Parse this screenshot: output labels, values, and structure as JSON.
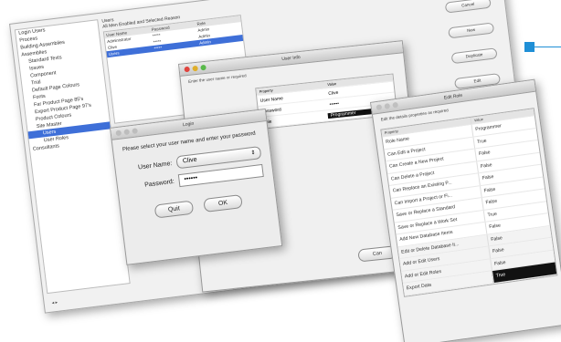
{
  "main_window": {
    "tree_items": [
      {
        "label": "Login Users",
        "indent": 0,
        "selected": false
      },
      {
        "label": "Process",
        "indent": 0,
        "selected": false
      },
      {
        "label": "Building Assemblies",
        "indent": 0,
        "selected": false
      },
      {
        "label": "Assemblies",
        "indent": 0,
        "selected": false
      },
      {
        "label": "Standard Texts",
        "indent": 1,
        "selected": false
      },
      {
        "label": "Issues",
        "indent": 1,
        "selected": false
      },
      {
        "label": "Component",
        "indent": 1,
        "selected": false
      },
      {
        "label": "Trial",
        "indent": 1,
        "selected": false
      },
      {
        "label": "Default Page Colours",
        "indent": 1,
        "selected": false
      },
      {
        "label": "Fonts",
        "indent": 1,
        "selected": false
      },
      {
        "label": "Far Product Page 85's",
        "indent": 1,
        "selected": false
      },
      {
        "label": "Export Product Page 97's",
        "indent": 1,
        "selected": false
      },
      {
        "label": "Product Colours",
        "indent": 1,
        "selected": false
      },
      {
        "label": "Site Master",
        "indent": 1,
        "selected": false
      },
      {
        "label": "Users",
        "indent": 2,
        "selected": true
      },
      {
        "label": "User Roles",
        "indent": 2,
        "selected": false
      },
      {
        "label": "Consultants",
        "indent": 0,
        "selected": false
      }
    ],
    "users_heading": "Users",
    "users_caption": "All Men Enabled and Selected Reason",
    "users_columns": [
      "User Name",
      "Password",
      "Role"
    ],
    "users_rows": [
      {
        "cells": [
          "Administrator",
          "*****",
          "Admin"
        ],
        "selected": false
      },
      {
        "cells": [
          "Clive",
          "*****",
          "Admin"
        ],
        "selected": false
      },
      {
        "cells": [
          "Users",
          "*****",
          "Admin"
        ],
        "selected": true
      }
    ],
    "side_buttons": [
      "OK",
      "Cancel",
      "New",
      "Duplicate",
      "Edit",
      "Delete"
    ]
  },
  "user_window": {
    "title": "User Info",
    "instruction": "Enter the user name or required",
    "columns": [
      "Property",
      "Value"
    ],
    "rows": [
      {
        "cells": [
          "User Name",
          "Clive"
        ],
        "black": false
      },
      {
        "cells": [
          "Password",
          "••••••"
        ],
        "black": false
      },
      {
        "cells": [
          "Role",
          "Programmer"
        ],
        "black": true
      }
    ],
    "cancel_label": "Can"
  },
  "login_window": {
    "title": "Login",
    "message": "Please select your user name and enter your password",
    "username_label": "User Name:",
    "username_value": "Clive",
    "password_label": "Password:",
    "password_value": "••••••",
    "quit_label": "Quit",
    "ok_label": "OK"
  },
  "role_window": {
    "title": "Edit Role",
    "instruction": "Edit the details properties as required",
    "columns": [
      "Property",
      "Value"
    ],
    "rows": [
      {
        "cells": [
          "Role Name",
          "Programmer"
        ],
        "alt": false,
        "black": false
      },
      {
        "cells": [
          "Can Edit a Project",
          "True"
        ],
        "alt": false,
        "black": false
      },
      {
        "cells": [
          "Can Create a New Project",
          "False"
        ],
        "alt": false,
        "black": false
      },
      {
        "cells": [
          "Can Delete a Project",
          "False"
        ],
        "alt": false,
        "black": false
      },
      {
        "cells": [
          "Can Replace an Existing P...",
          "False"
        ],
        "alt": false,
        "black": false
      },
      {
        "cells": [
          "Can Import a Project or Fi...",
          "False"
        ],
        "alt": false,
        "black": false
      },
      {
        "cells": [
          "Save or Replace a Standard",
          "False"
        ],
        "alt": false,
        "black": false
      },
      {
        "cells": [
          "Save or Replace a Work Set",
          "True"
        ],
        "alt": false,
        "black": false
      },
      {
        "cells": [
          "Add New Database Items",
          "False"
        ],
        "alt": false,
        "black": false
      },
      {
        "cells": [
          "Edit or Delete Database It...",
          "False"
        ],
        "alt": true,
        "black": false
      },
      {
        "cells": [
          "Add or Edit Users",
          "False"
        ],
        "alt": true,
        "black": false
      },
      {
        "cells": [
          "Add or Edit Roles",
          "False"
        ],
        "alt": true,
        "black": false
      },
      {
        "cells": [
          "Export Data",
          "True"
        ],
        "alt": true,
        "black": true
      }
    ]
  },
  "colors": {
    "callout": "#1f8fd6",
    "selection": "#3e6fd8"
  }
}
